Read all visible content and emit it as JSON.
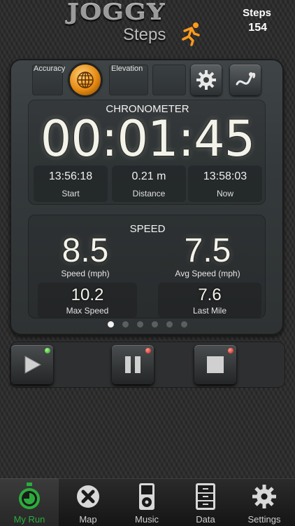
{
  "header": {
    "logo_text": "JOGGY",
    "logo_sub": "Steps",
    "steps_label": "Steps",
    "steps_value": "154"
  },
  "gps": {
    "accuracy_label": "Accuracy",
    "elevation_label": "Elevation"
  },
  "chronometer": {
    "title": "CHRONOMETER",
    "time": "00:01:45",
    "start": {
      "value": "13:56:18",
      "label": "Start"
    },
    "distance": {
      "value": "0.21 m",
      "label": "Distance"
    },
    "now": {
      "value": "13:58:03",
      "label": "Now"
    }
  },
  "speed": {
    "title": "SPEED",
    "speed": {
      "value": "8.5",
      "label": "Speed (mph)"
    },
    "avg_speed": {
      "value": "7.5",
      "label": "Avg Speed (mph)"
    },
    "max_speed": {
      "value": "10.2",
      "label": "Max Speed"
    },
    "last_mile": {
      "value": "7.6",
      "label": "Last Mile"
    }
  },
  "pager": {
    "count": 6,
    "active_index": 0
  },
  "controls": [
    {
      "name": "play",
      "led": "green"
    },
    {
      "name": "pause",
      "led": "red"
    },
    {
      "name": "stop",
      "led": "red"
    }
  ],
  "tabs": [
    {
      "label": "My Run",
      "icon": "stopwatch-icon",
      "active": true
    },
    {
      "label": "Map",
      "icon": "map-icon",
      "active": false
    },
    {
      "label": "Music",
      "icon": "ipod-icon",
      "active": false
    },
    {
      "label": "Data",
      "icon": "cabinet-icon",
      "active": false
    },
    {
      "label": "Settings",
      "icon": "gear-icon",
      "active": false
    }
  ],
  "colors": {
    "accent_active": "#2cab3c",
    "led_green": "#1c9b1c",
    "led_red": "#c81a1a",
    "globe": "#e58a12"
  }
}
